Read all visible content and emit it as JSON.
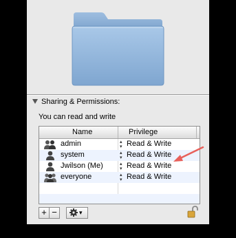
{
  "sharing": {
    "title": "Sharing & Permissions:",
    "access_text": "You can read and write",
    "columns": {
      "name": "Name",
      "privilege": "Privilege"
    },
    "rows": [
      {
        "name": "admin",
        "privilege": "Read & Write",
        "icon": "group-icon"
      },
      {
        "name": "system",
        "privilege": "Read & Write",
        "icon": "user-icon"
      },
      {
        "name": "Jwilson (Me)",
        "privilege": "Read & Write",
        "icon": "user-icon"
      },
      {
        "name": "everyone",
        "privilege": "Read & Write",
        "icon": "everyone-icon"
      }
    ],
    "stepper_glyph": "▴▾"
  },
  "toolbar": {
    "add_label": "+",
    "remove_label": "−",
    "action_label": "▾"
  },
  "colors": {
    "arrow": "#e8605a",
    "folder": "#8fb3d9",
    "row_alt": "#edf3fe"
  }
}
